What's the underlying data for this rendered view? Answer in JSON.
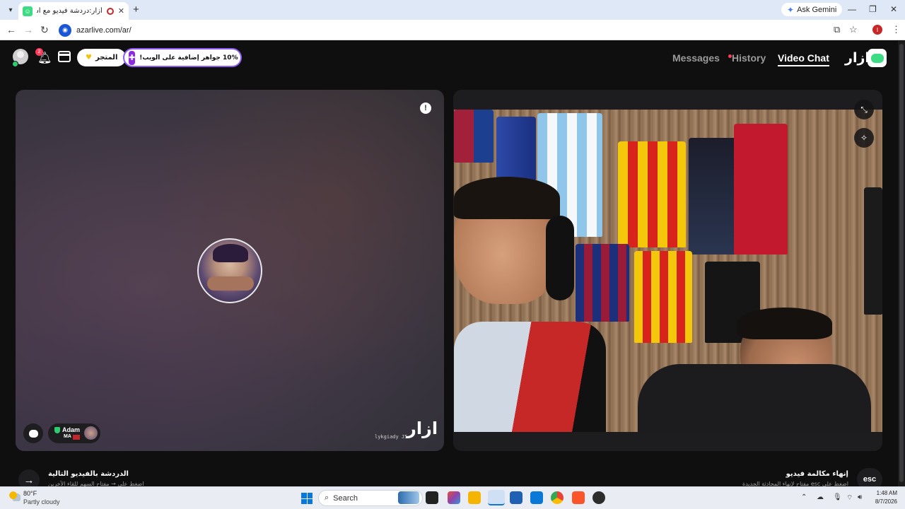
{
  "browser": {
    "tab_title": "أزار:دردشة فيديو مع أشخاص",
    "tab_close": "✕",
    "new_tab": "+",
    "ask_gemini": "Ask Gemini",
    "url": "azarlive.com/ar/",
    "profile_initial": "I"
  },
  "header": {
    "bell_badge": "2",
    "store_label": "المتجر",
    "promo_label": "10% جواهر إضافية على الويب!",
    "nav": {
      "messages": "Messages",
      "history": "History",
      "video_chat": "Video Chat"
    },
    "logo_text": "ازار"
  },
  "peer_panel": {
    "report_label": "!",
    "user_name": "Adam",
    "user_country": "MA",
    "watermark_id": "lykgiady J5",
    "watermark_logo": "ازار"
  },
  "bottom": {
    "next_title": "الدردشة بالفيديو التالية",
    "next_sub": "اضغط على → مفتاح السهم للقاء الآخرين",
    "end_title": "إنهاء مكالمة فيديو",
    "end_sub": "اضغط على esc مفتاح لإنهاء المحادثة الجديدة",
    "esc_label": "esc",
    "next_arrow": "→"
  },
  "taskbar": {
    "temp": "80°F",
    "weather": "Partly cloudy",
    "search_placeholder": "Search",
    "time": "1:48 AM",
    "date": "8/7/2026"
  }
}
